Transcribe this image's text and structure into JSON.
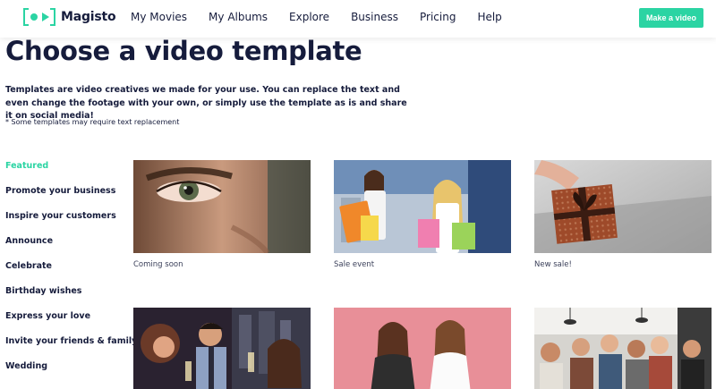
{
  "brand": {
    "name": "Magisto",
    "accent": "#2bd4a3",
    "text_color": "#161c3c"
  },
  "nav": {
    "items": [
      "My Movies",
      "My Albums",
      "Explore",
      "Business",
      "Pricing",
      "Help"
    ],
    "cta_label": "Make a video"
  },
  "main": {
    "title": "Choose a video template",
    "intro": "Templates are video creatives we made for your use. You can replace the text and even change the footage with your own, or simply use the template as is and share it on social media!",
    "note": "* Some templates may require text replacement"
  },
  "sidebar": {
    "categories": [
      "Featured",
      "Promote your business",
      "Inspire your customers",
      "Announce",
      "Celebrate",
      "Birthday wishes",
      "Express your love",
      "Invite your friends & family",
      "Wedding"
    ],
    "active_index": 0
  },
  "templates": [
    {
      "caption": "Coming soon",
      "image": "eye-closeup"
    },
    {
      "caption": "Sale event",
      "image": "shopping-women"
    },
    {
      "caption": "New sale!",
      "image": "gift-box"
    },
    {
      "caption": "",
      "image": "friends-toast"
    },
    {
      "caption": "",
      "image": "two-women-pink"
    },
    {
      "caption": "",
      "image": "office-celebration"
    }
  ]
}
